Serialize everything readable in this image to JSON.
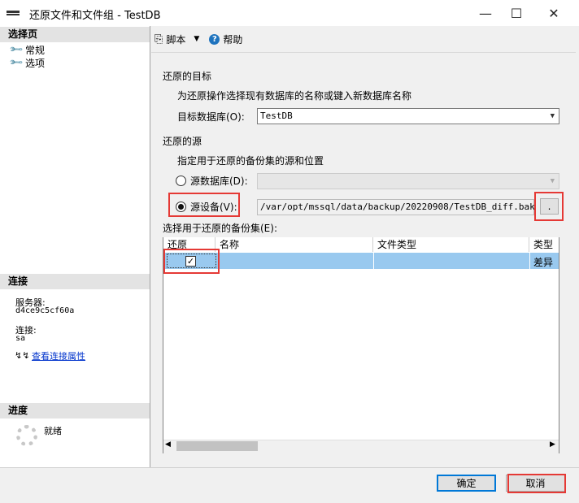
{
  "window": {
    "title": "还原文件和文件组 - TestDB",
    "minimize": "—",
    "maximize": "☐",
    "close": "✕"
  },
  "left_panel": {
    "select_page_header": "选择页",
    "pages": [
      {
        "label": "常规"
      },
      {
        "label": "选项"
      }
    ],
    "connection_header": "连接",
    "server_label": "服务器:",
    "server_value": "d4ce9c5cf60a",
    "connection_label": "连接:",
    "connection_value": "sa",
    "view_props_link": "查看连接属性",
    "progress_header": "进度",
    "progress_status": "就绪"
  },
  "toolbar": {
    "script_label": "脚本",
    "help_label": "帮助"
  },
  "restore_target": {
    "section_label": "还原的目标",
    "instruction": "为还原操作选择现有数据库的名称或键入新数据库名称",
    "db_label": "目标数据库(O):",
    "db_value": "TestDB"
  },
  "restore_source": {
    "section_label": "还原的源",
    "instruction": "指定用于还原的备份集的源和位置",
    "source_db_label": "源数据库(D):",
    "source_db_value": "",
    "source_device_label": "源设备(V):",
    "source_device_value": "/var/opt/mssql/data/backup/20220908/TestDB_diff.bak",
    "browse_label": "."
  },
  "backup_sets": {
    "label": "选择用于还原的备份集(E):",
    "columns": [
      "还原",
      "名称",
      "文件类型",
      "类型"
    ],
    "rows": [
      {
        "restore_checked": true,
        "check_glyph": "✓",
        "name": "",
        "file_type": "",
        "type": "差异"
      }
    ]
  },
  "footer": {
    "ok_label": "确定",
    "cancel_label": "取消"
  },
  "colors": {
    "highlight_red": "#e53935",
    "selected_row": "#99c9ef",
    "link": "#0033cc"
  }
}
